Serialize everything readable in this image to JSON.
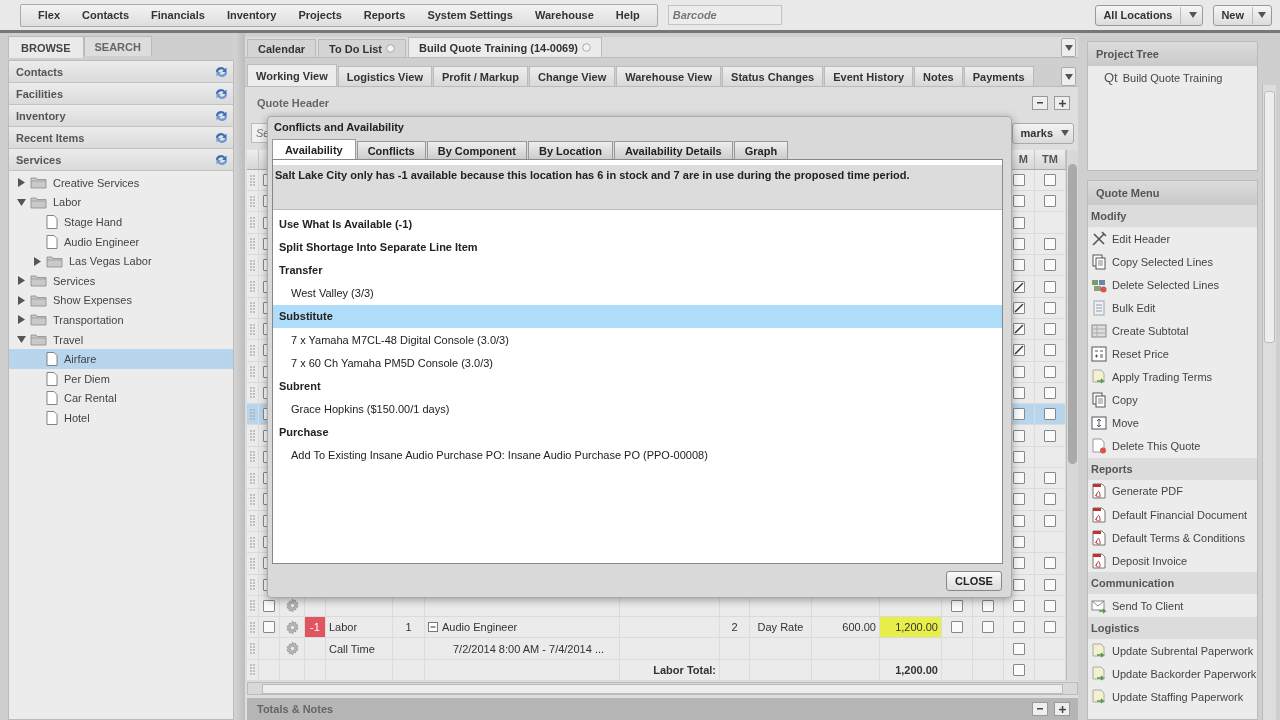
{
  "top_menu": [
    {
      "label": "Flex"
    },
    {
      "label": "Contacts"
    },
    {
      "label": "Financials"
    },
    {
      "label": "Inventory"
    },
    {
      "label": "Projects"
    },
    {
      "label": "Reports"
    },
    {
      "label": "System Settings"
    },
    {
      "label": "Warehouse"
    },
    {
      "label": "Help"
    }
  ],
  "barcode": {
    "placeholder": "Barcode"
  },
  "location_selector": {
    "value": "All Locations"
  },
  "new_button": {
    "label": "New"
  },
  "sidebar": {
    "tabs": [
      {
        "label": "BROWSE",
        "selected": true
      },
      {
        "label": "SEARCH",
        "selected": false
      }
    ],
    "sections": [
      {
        "label": "Contacts"
      },
      {
        "label": "Facilities"
      },
      {
        "label": "Inventory"
      },
      {
        "label": "Recent Items"
      },
      {
        "label": "Services",
        "tree": [
          {
            "label": "Creative Services",
            "kind": "folder",
            "expanded": false,
            "selected": false
          },
          {
            "label": "Labor",
            "kind": "folder",
            "expanded": true,
            "selected": false,
            "children": [
              {
                "label": "Stage Hand",
                "kind": "item",
                "selected": false
              },
              {
                "label": "Audio Engineer",
                "kind": "item",
                "selected": false
              },
              {
                "label": "Las Vegas Labor",
                "kind": "folder",
                "expanded": false,
                "selected": false
              }
            ]
          },
          {
            "label": "Services",
            "kind": "folder",
            "expanded": false,
            "selected": false
          },
          {
            "label": "Show Expenses",
            "kind": "folder",
            "expanded": false,
            "selected": false
          },
          {
            "label": "Transportation",
            "kind": "folder",
            "expanded": false,
            "selected": false
          },
          {
            "label": "Travel",
            "kind": "folder",
            "expanded": true,
            "selected": false,
            "children": [
              {
                "label": "Airfare",
                "kind": "item",
                "selected": true
              },
              {
                "label": "Per Diem",
                "kind": "item",
                "selected": false
              },
              {
                "label": "Car Rental",
                "kind": "item",
                "selected": false
              },
              {
                "label": "Hotel",
                "kind": "item",
                "selected": false
              }
            ]
          }
        ]
      }
    ]
  },
  "doc_tabs": [
    {
      "label": "Calendar",
      "selected": false,
      "closable": false
    },
    {
      "label": "To Do List",
      "selected": false,
      "closable": true
    },
    {
      "label": "Build Quote Training (14-0069)",
      "selected": true,
      "closable": true
    }
  ],
  "view_tabs": [
    {
      "label": "Working View",
      "selected": true
    },
    {
      "label": "Logistics View",
      "selected": false
    },
    {
      "label": "Profit / Markup",
      "selected": false
    },
    {
      "label": "Change View",
      "selected": false
    },
    {
      "label": "Warehouse View",
      "selected": false
    },
    {
      "label": "Status Changes",
      "selected": false
    },
    {
      "label": "Event History",
      "selected": false
    },
    {
      "label": "Notes",
      "selected": false
    },
    {
      "label": "Payments",
      "selected": false
    }
  ],
  "quote_header": {
    "title": "Quote Header"
  },
  "toolbar": {
    "search_placeholder": "Se",
    "bookmarks_label": "marks"
  },
  "grid": {
    "columns": [
      {
        "label": "M"
      },
      {
        "label": "TM"
      }
    ],
    "rows": [
      {
        "select": false,
        "m": false,
        "tm": false,
        "selected": false
      },
      {
        "select": false,
        "m": false,
        "tm": false,
        "selected": false
      },
      {
        "select": false,
        "m": false,
        "selected": false
      },
      {
        "select": false,
        "m": false,
        "tm": false,
        "selected": false
      },
      {
        "select": false,
        "m": false,
        "tm": false,
        "selected": false
      },
      {
        "select": false,
        "m": true,
        "tm": false,
        "selected": false
      },
      {
        "select": false,
        "m": true,
        "tm": false,
        "selected": false
      },
      {
        "select": false,
        "m": true,
        "tm": false,
        "selected": false
      },
      {
        "select": false,
        "m": true,
        "tm": false,
        "selected": false
      },
      {
        "select": false,
        "m": false,
        "tm": false,
        "selected": false
      },
      {
        "select": false,
        "m": false,
        "tm": false,
        "selected": false
      },
      {
        "select": false,
        "m": false,
        "tm": false,
        "selected": true
      },
      {
        "select": false,
        "m": false,
        "tm": false,
        "selected": false
      },
      {
        "select": false,
        "m": false,
        "selected": false
      },
      {
        "select": false,
        "m": false,
        "tm": false,
        "selected": false
      },
      {
        "select": false,
        "m": false,
        "tm": false,
        "selected": false
      },
      {
        "select": false,
        "m": false,
        "tm": false,
        "selected": false
      },
      {
        "select": false,
        "m": false,
        "selected": false
      },
      {
        "select": false,
        "m": false,
        "tm": false,
        "selected": false
      },
      {
        "select": false,
        "m": false,
        "tm": false,
        "selected": false
      }
    ],
    "line_rows": [
      {
        "kind": "subtotal",
        "select": false,
        "c1": false,
        "c2": false,
        "m": false,
        "tm": false
      },
      {
        "kind": "item",
        "select": false,
        "badge": "-1",
        "type": "Labor",
        "qty": "1",
        "description": "Audio Engineer",
        "days": "2",
        "rate": "Day Rate",
        "price": "600.00",
        "total": "1,200.00",
        "c1": false,
        "c2": false,
        "m": false,
        "tm": false
      },
      {
        "kind": "call_time",
        "type": "Call Time",
        "description": "7/2/2014 8:00 AM - 7/4/2014 ...",
        "m": false
      },
      {
        "kind": "total",
        "label": "Labor Total:",
        "total": "1,200.00",
        "m": false
      }
    ]
  },
  "totals_notes": {
    "title": "Totals & Notes"
  },
  "project_tree": {
    "title": "Project Tree",
    "items": [
      {
        "badge": "Qt",
        "label": "Build Quote Training"
      }
    ]
  },
  "quote_menu": {
    "title": "Quote Menu",
    "groups": [
      {
        "title": "Modify",
        "items": [
          {
            "label": "Edit Header",
            "kind": "tools"
          },
          {
            "label": "Copy Selected Lines",
            "kind": "copy"
          },
          {
            "label": "Delete Selected Lines",
            "kind": "delete_lines"
          },
          {
            "label": "Bulk Edit",
            "kind": "list"
          },
          {
            "label": "Create Subtotal",
            "kind": "table"
          },
          {
            "label": "Reset Price",
            "kind": "calc"
          },
          {
            "label": "Apply Trading Terms",
            "kind": "apply"
          },
          {
            "label": "Copy",
            "kind": "copy"
          },
          {
            "label": "Move",
            "kind": "move"
          },
          {
            "label": "Delete This Quote",
            "kind": "delete_doc"
          }
        ]
      },
      {
        "title": "Reports",
        "items": [
          {
            "label": "Generate PDF",
            "kind": "pdf"
          },
          {
            "label": "Default Financial Document",
            "kind": "pdf"
          },
          {
            "label": "Default Terms & Conditions",
            "kind": "pdf"
          },
          {
            "label": "Deposit Invoice",
            "kind": "pdf"
          }
        ]
      },
      {
        "title": "Communication",
        "items": [
          {
            "label": "Send To Client",
            "kind": "send"
          }
        ]
      },
      {
        "title": "Logistics",
        "items": [
          {
            "label": "Update Subrental Paperwork",
            "kind": "apply"
          },
          {
            "label": "Update Backorder Paperwork",
            "kind": "apply"
          },
          {
            "label": "Update Staffing Paperwork",
            "kind": "apply"
          }
        ]
      }
    ]
  },
  "dialog": {
    "title": "Conflicts and Availability",
    "tabs": [
      {
        "label": "Availability",
        "selected": true
      },
      {
        "label": "Conflicts",
        "selected": false
      },
      {
        "label": "By Component",
        "selected": false
      },
      {
        "label": "By Location",
        "selected": false
      },
      {
        "label": "Availability Details",
        "selected": false
      },
      {
        "label": "Graph",
        "selected": false
      }
    ],
    "message": "Salt Lake City only has -1 available because this location has 6 in stock and 7 are in use during the proposed time period.",
    "options": [
      {
        "text": "Use What Is Available (-1)",
        "kind": "heading",
        "selected": false
      },
      {
        "text": "Split Shortage Into Separate Line Item",
        "kind": "heading",
        "selected": false
      },
      {
        "text": "Transfer",
        "kind": "heading",
        "selected": false
      },
      {
        "text": "West Valley (3/3)",
        "kind": "choice",
        "selected": false
      },
      {
        "text": "Substitute",
        "kind": "heading",
        "selected": true
      },
      {
        "text": "7 x Yamaha M7CL-48 Digital Console (3.0/3)",
        "kind": "choice",
        "selected": false
      },
      {
        "text": "7 x 60 Ch Yamaha PM5D Console (3.0/3)",
        "kind": "choice",
        "selected": false
      },
      {
        "text": "Subrent",
        "kind": "heading",
        "selected": false
      },
      {
        "text": "Grace Hopkins ($150.00/1 days)",
        "kind": "choice",
        "selected": false
      },
      {
        "text": "Purchase",
        "kind": "heading",
        "selected": false
      },
      {
        "text": "Add To Existing Insane Audio Purchase PO: Insane Audio Purchase PO (PPO-00008)",
        "kind": "choice",
        "selected": false
      }
    ],
    "close_label": "CLOSE"
  }
}
